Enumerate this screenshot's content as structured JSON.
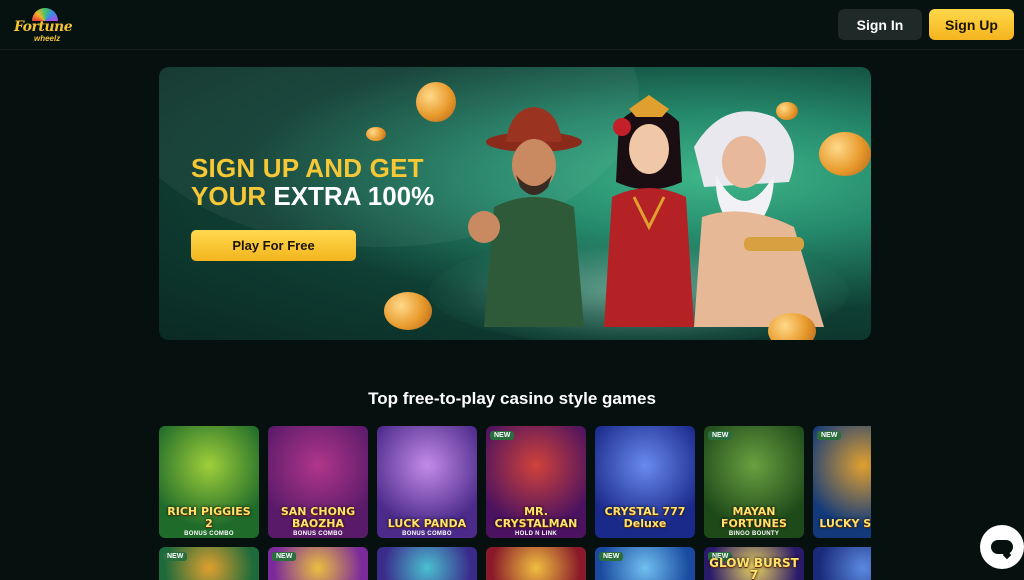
{
  "header": {
    "logo_text": "Fortune",
    "logo_subtext": "wheelz",
    "signin_label": "Sign In",
    "signup_label": "Sign Up"
  },
  "hero": {
    "line1": "SIGN UP AND GET",
    "line2_highlight": "YOUR",
    "line2_rest": "EXTRA 100%",
    "cta_label": "Play For Free"
  },
  "games": {
    "section_title": "Top free-to-play casino style games",
    "row1": [
      {
        "name": "RICH PIGGIES 2",
        "tag": "BONUS COMBO",
        "new": false,
        "colors": [
          "#1f6b2a",
          "#9fcf3a"
        ]
      },
      {
        "name": "SAN CHONG BAOZHA",
        "tag": "BONUS COMBO",
        "new": false,
        "colors": [
          "#5a1a6a",
          "#b0368a"
        ]
      },
      {
        "name": "LUCK PANDA",
        "tag": "BONUS COMBO",
        "new": false,
        "colors": [
          "#4b2a8a",
          "#c48be8"
        ]
      },
      {
        "name": "MR. CRYSTALMAN",
        "tag": "HOLD N LINK",
        "new": true,
        "badge": "NEW",
        "colors": [
          "#4a1260",
          "#d0423a"
        ]
      },
      {
        "name": "CRYSTAL 777 Deluxe",
        "tag": "",
        "new": false,
        "colors": [
          "#1a2a8a",
          "#6a8af0"
        ]
      },
      {
        "name": "MAYAN FORTUNES",
        "tag": "BINGO BOUNTY",
        "new": true,
        "badge": "NEW",
        "colors": [
          "#1e4a1a",
          "#6aa040"
        ]
      },
      {
        "name": "LUCKY SHOOT",
        "tag": "",
        "new": true,
        "badge": "NEW",
        "colors": [
          "#123a7a",
          "#e0a030"
        ]
      }
    ],
    "row2": [
      {
        "name": "",
        "new": true,
        "badge": "NEW",
        "colors": [
          "#1e6a3a",
          "#e0a030"
        ]
      },
      {
        "name": "",
        "new": true,
        "badge": "NEW",
        "colors": [
          "#7a2a9a",
          "#e8c040"
        ]
      },
      {
        "name": "",
        "new": false,
        "colors": [
          "#3a2a8a",
          "#4ac0d0"
        ]
      },
      {
        "name": "",
        "new": false,
        "colors": [
          "#8a1a2a",
          "#f0c040"
        ]
      },
      {
        "name": "",
        "new": true,
        "badge": "NEW",
        "colors": [
          "#1a4aa0",
          "#70c0f0"
        ]
      },
      {
        "name": "GLOW BURST 7",
        "new": true,
        "badge": "NEW",
        "colors": [
          "#2a1a6a",
          "#e8d060"
        ]
      },
      {
        "name": "",
        "new": false,
        "colors": [
          "#1a2a7a",
          "#5a8ae0"
        ]
      }
    ]
  },
  "chat": {
    "icon": "chat-bubble-icon"
  }
}
